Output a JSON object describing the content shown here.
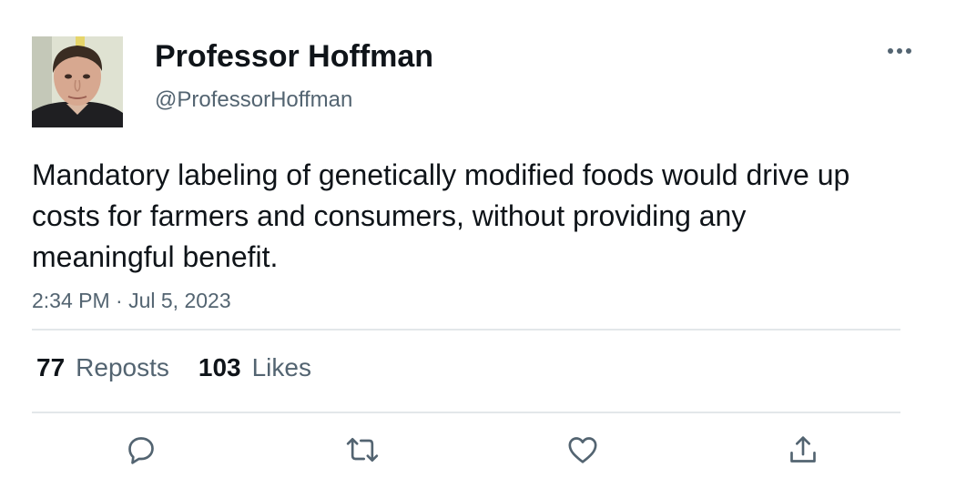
{
  "author": {
    "display_name": "Professor Hoffman",
    "handle": "@ProfessorHoffman",
    "avatar_icon": "profile-photo"
  },
  "tweet": {
    "text": "Mandatory labeling of genetically modified foods would drive up costs for farmers and consumers, without providing any meaningful benefit.",
    "timestamp": "2:34 PM · Jul 5, 2023"
  },
  "stats": {
    "reposts_count": "77",
    "reposts_label": "Reposts",
    "likes_count": "103",
    "likes_label": "Likes"
  },
  "actions": {
    "more_icon": "more-horizontal-icon",
    "reply_icon": "reply-icon",
    "repost_icon": "repost-icon",
    "like_icon": "heart-icon",
    "share_icon": "share-icon"
  },
  "colors": {
    "primary_text": "#0f1419",
    "secondary_text": "#536471",
    "divider": "#e3e7ea",
    "background": "#ffffff"
  }
}
